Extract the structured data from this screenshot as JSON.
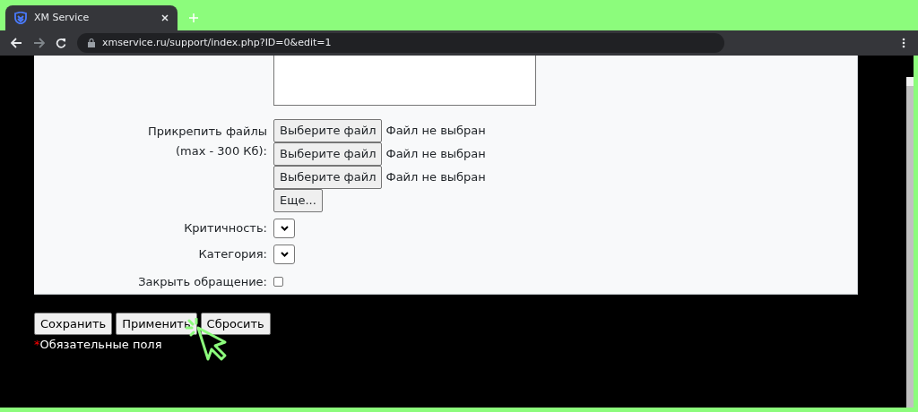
{
  "browser": {
    "tab_title": "XM Service",
    "url": "xmservice.ru/support/index.php?ID=0&edit=1"
  },
  "form": {
    "attach_label": [
      "Прикрепить файлы",
      "(max - 300 Кб):"
    ],
    "files": [
      {
        "button": "Выберите файл",
        "status": "Файл не выбран"
      },
      {
        "button": "Выберите файл",
        "status": "Файл не выбран"
      },
      {
        "button": "Выберите файл",
        "status": "Файл не выбран"
      }
    ],
    "more_button": "Еще...",
    "selects": [
      {
        "label": "Критичность:"
      },
      {
        "label": "Категория:"
      }
    ],
    "close_ticket": {
      "label": "Закрыть обращение:",
      "checked": false
    }
  },
  "buttons": [
    "Сохранить",
    "Применить",
    "Сбросить"
  ],
  "required_note": {
    "mark": "*",
    "text": "Обязательные поля"
  }
}
